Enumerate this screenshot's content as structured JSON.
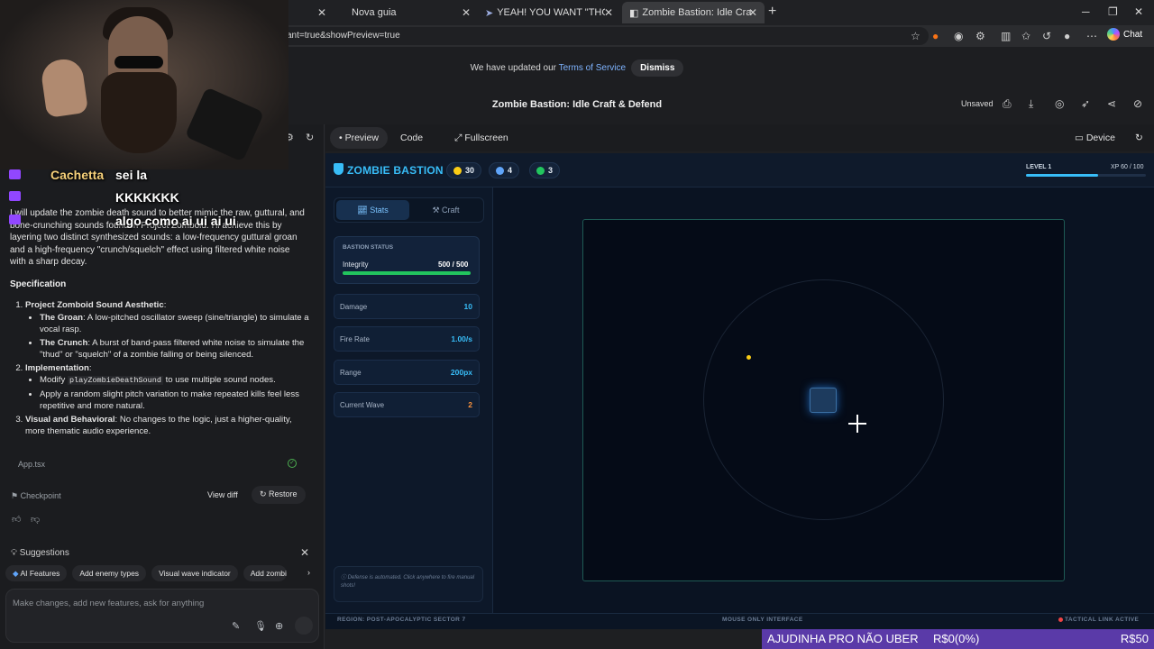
{
  "browser": {
    "tabs": [
      {
        "label": "",
        "x": 0
      },
      {
        "label": "Nova guia"
      },
      {
        "label": "YEAH! YOU WANT \"THOSE GAMES,\""
      },
      {
        "label": "Zombie Bastion: Idle Craft & D | G"
      }
    ],
    "new_tab": "+",
    "url": "ant=true&showPreview=true",
    "chat_label": "Chat"
  },
  "banner": {
    "text": "We have updated our ",
    "link": "Terms of Service",
    "dismiss": "Dismiss"
  },
  "app": {
    "title": "Zombie Bastion: Idle Craft & Defend",
    "unsaved": "Unsaved"
  },
  "chat": {
    "body": "I will update the zombie death sound to better mimic the raw, guttural, and bone-crunching sounds found in Project Zomboid. I'll achieve this by layering two distinct synthesized sounds: a low-frequency guttural groan and a high-frequency \"crunch/squelch\" effect using filtered white noise with a sharp decay.",
    "spec_heading": "Specification",
    "spec": {
      "item1_title": "Project Zomboid Sound Aesthetic",
      "item1_a_title": "The Groan",
      "item1_a_text": ": A low-pitched oscillator sweep (sine/triangle) to simulate a vocal rasp.",
      "item1_b_title": "The Crunch",
      "item1_b_text": ": A burst of band-pass filtered white noise to simulate the \"thud\" or \"squelch\" of a zombie falling or being silenced.",
      "item2_title": "Implementation",
      "item2_a_pre": "Modify ",
      "item2_a_code": "playZombieDeathSound",
      "item2_a_post": " to use multiple sound nodes.",
      "item2_b": "Apply a random slight pitch variation to make repeated kills feel less repetitive and more natural.",
      "item3_title": "Visual and Behavioral",
      "item3_text": ": No changes to the logic, just a higher-quality, more thematic audio experience."
    },
    "file": "App.tsx",
    "checkpoint": "Checkpoint",
    "view_diff": "View diff",
    "restore": "Restore",
    "suggestions_label": "Suggestions",
    "suggestions": [
      "AI Features",
      "Add enemy types",
      "Visual wave indicator",
      "Add zombie g"
    ],
    "input_placeholder": "Make changes, add new features, ask for anything"
  },
  "overlay": {
    "user": "Cachetta",
    "msg1": "sei la",
    "msg2": "KKKKKKK",
    "msg3": "algo como  ai ui ai ui"
  },
  "preview": {
    "tabs": [
      "Preview",
      "Code",
      "Fullscreen"
    ],
    "device": "Device"
  },
  "game": {
    "title": "ZOMBIE BASTION",
    "resources": {
      "gold": "30",
      "gems": "4",
      "bio": "3"
    },
    "level": "LEVEL 1",
    "xp": "XP 60 / 100",
    "xp_fraction": 0.6,
    "tabs": {
      "stats": "Stats",
      "craft": "Craft"
    },
    "status_heading": "BASTION STATUS",
    "integrity_label": "Integrity",
    "integrity_value": "500 / 500",
    "integrity_fraction": 1.0,
    "stats": [
      {
        "label": "Damage",
        "value": "10"
      },
      {
        "label": "Fire Rate",
        "value": "1.00/s"
      },
      {
        "label": "Range",
        "value": "200px"
      },
      {
        "label": "Current Wave",
        "value": "2"
      }
    ],
    "note": "Defense is automated. Click anywhere to fire manual shots!",
    "footer_left": "REGION: POST-APOCALYPTIC SECTOR 7",
    "footer_mid": "MOUSE ONLY INTERFACE",
    "footer_right": "TACTICAL LINK ACTIVE"
  },
  "donation": {
    "label": "AJUDINHA PRO NÃO UBER",
    "current": "R$0(0%)",
    "goal": "R$50"
  },
  "colors": {
    "accent": "#38bdf8",
    "integrity": "#22c55e",
    "zombie": "#facc15",
    "donation_bar": "#5a3aa8"
  }
}
